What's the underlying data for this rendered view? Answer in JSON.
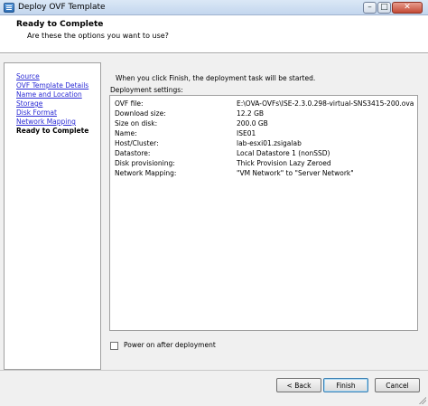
{
  "window": {
    "title": "Deploy OVF Template",
    "controls": {
      "minimize": "–",
      "maximize": "□",
      "close": "✕"
    }
  },
  "header": {
    "title": "Ready to Complete",
    "subtitle": "Are these the options you want to use?"
  },
  "nav": {
    "items": [
      {
        "label": "Source",
        "state": "link"
      },
      {
        "label": "OVF Template Details",
        "state": "link"
      },
      {
        "label": "Name and Location",
        "state": "link"
      },
      {
        "label": "Storage",
        "state": "link"
      },
      {
        "label": "Disk Format",
        "state": "link"
      },
      {
        "label": "Network Mapping",
        "state": "link"
      },
      {
        "label": "Ready to Complete",
        "state": "current"
      }
    ]
  },
  "main": {
    "intro": "When you click Finish, the deployment task will be started.",
    "settings_label": "Deployment settings:",
    "settings": [
      {
        "key": "OVF file:",
        "value": "E:\\OVA-OVFs\\ISE-2.3.0.298-virtual-SNS3415-200.ova"
      },
      {
        "key": "Download size:",
        "value": "12.2 GB"
      },
      {
        "key": "Size on disk:",
        "value": "200.0 GB"
      },
      {
        "key": "Name:",
        "value": "ISE01"
      },
      {
        "key": "Host/Cluster:",
        "value": "lab-esxi01.zsigalab"
      },
      {
        "key": "Datastore:",
        "value": "Local Datastore 1 (nonSSD)"
      },
      {
        "key": "Disk provisioning:",
        "value": "Thick Provision Lazy Zeroed"
      },
      {
        "key": "Network Mapping:",
        "value": "\"VM Network\" to \"Server Network\""
      }
    ],
    "power_on_label": "Power on after deployment",
    "power_on_checked": false
  },
  "footer": {
    "back_label": "< Back",
    "finish_label": "Finish",
    "cancel_label": "Cancel"
  }
}
